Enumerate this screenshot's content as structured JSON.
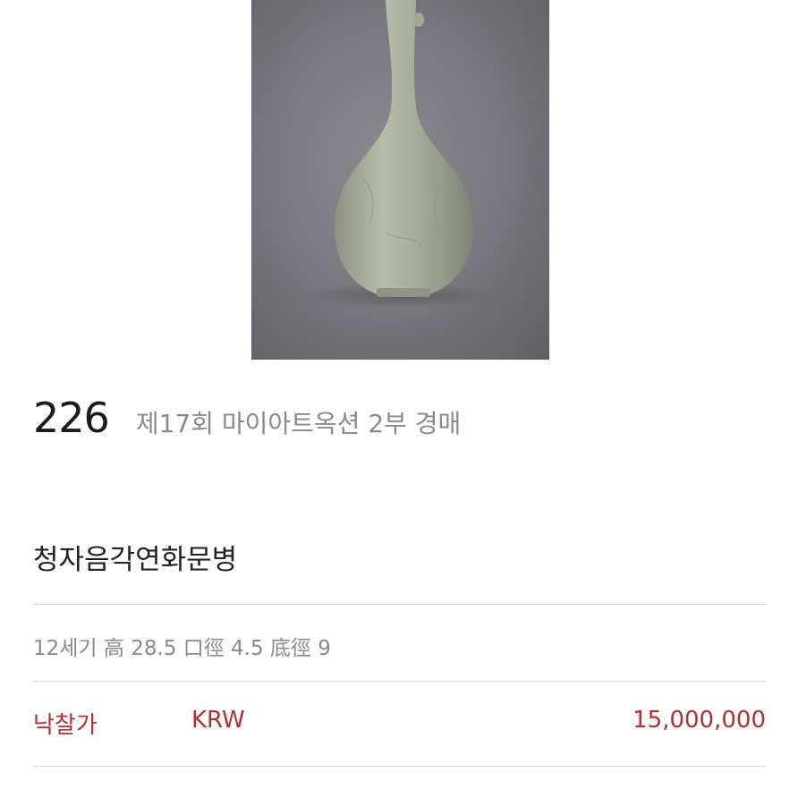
{
  "lot": {
    "number": "226",
    "sale_name": "제17회 마이아트옥션 2부 경매"
  },
  "item": {
    "title": "청자음각연화문병",
    "description": "12세기 高 28.5 口徑 4.5 底徑 9"
  },
  "price": {
    "label": "낙찰가",
    "currency": "KRW",
    "amount": "15,000,000"
  },
  "colors": {
    "accent": "#b2302f",
    "muted_text": "#8a8a8a",
    "photo_background": "#77767c",
    "vase_glaze": "#a9ae9c"
  }
}
